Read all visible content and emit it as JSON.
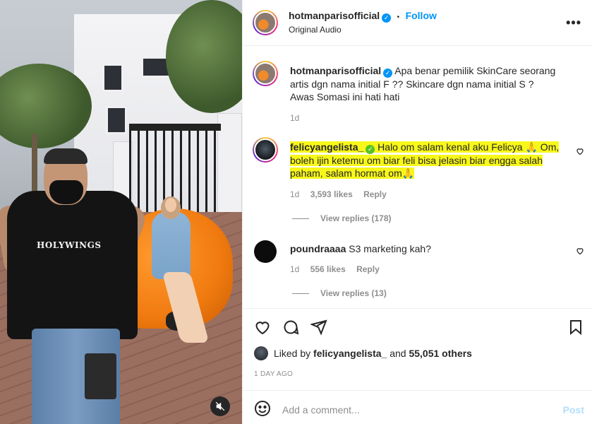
{
  "header": {
    "username": "hotmanparisofficial",
    "follow_label": "Follow",
    "separator": "•",
    "subtitle": "Original Audio",
    "more_label": "•••"
  },
  "media": {
    "shirt_text": "HOLYWINGS",
    "mute_icon": "speaker-muted-icon"
  },
  "caption": {
    "username": "hotmanparisofficial",
    "text": "Apa benar pemilik SkinCare seorang artis dgn nama initial F ?? Skincare dgn nama initial S ? Awas Somasi ini hati hati",
    "time": "1d"
  },
  "comments": [
    {
      "username": "felicyangelista_",
      "text": "Halo om salam kenal aku Felicya 🙏 Om, boleh ijin ketemu om biar feli bisa jelasin biar engga salah paham, salam hormat om🙏",
      "time": "1d",
      "likes": "3,593 likes",
      "reply_label": "Reply",
      "view_replies": "View replies (178)",
      "highlighted": true
    },
    {
      "username": "poundraaaa",
      "text": "S3 marketing kah?",
      "time": "1d",
      "likes": "556 likes",
      "reply_label": "Reply",
      "view_replies": "View replies (13)",
      "highlighted": false
    }
  ],
  "likes_summary": {
    "prefix": "Liked by",
    "user": "felicyangelista_",
    "and": "and",
    "others": "55,051 others"
  },
  "post_date": "1 DAY AGO",
  "add_comment": {
    "placeholder": "Add a comment...",
    "post_label": "Post"
  },
  "colors": {
    "accent": "#0095f6",
    "highlight": "#f7f71a",
    "muted_text": "#8e8e8e"
  }
}
